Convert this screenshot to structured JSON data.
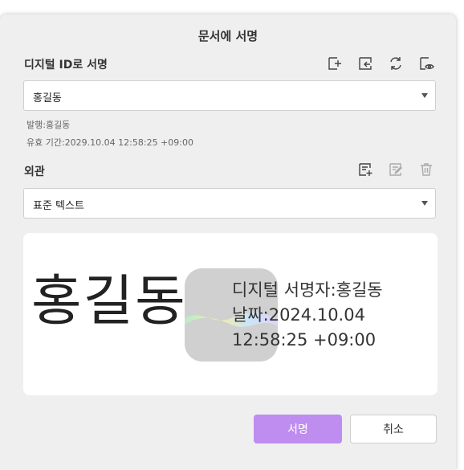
{
  "dialog": {
    "title": "문서에 서명"
  },
  "digital_id": {
    "label": "디지털 ID로 서명",
    "selected": "홍길동",
    "issuer_line": "발행:홍길동",
    "validity_line": "유효 기간:2029.10.04 12:58:25 +09:00",
    "icons": [
      "add-id-icon",
      "import-id-icon",
      "refresh-icon",
      "view-id-icon"
    ]
  },
  "appearance": {
    "label": "외관",
    "selected": "표준 텍스트",
    "icons": [
      "new-appearance-icon",
      "edit-appearance-icon",
      "delete-icon"
    ]
  },
  "preview": {
    "name": "홍길동",
    "line1": "디지털 서명자:홍길동",
    "line2": "날짜:2024.10.04",
    "line3": "12:58:25  +09:00"
  },
  "buttons": {
    "sign": "서명",
    "cancel": "취소"
  },
  "colors": {
    "primary": "#bf8df0",
    "dialog_bg": "#efefef"
  }
}
